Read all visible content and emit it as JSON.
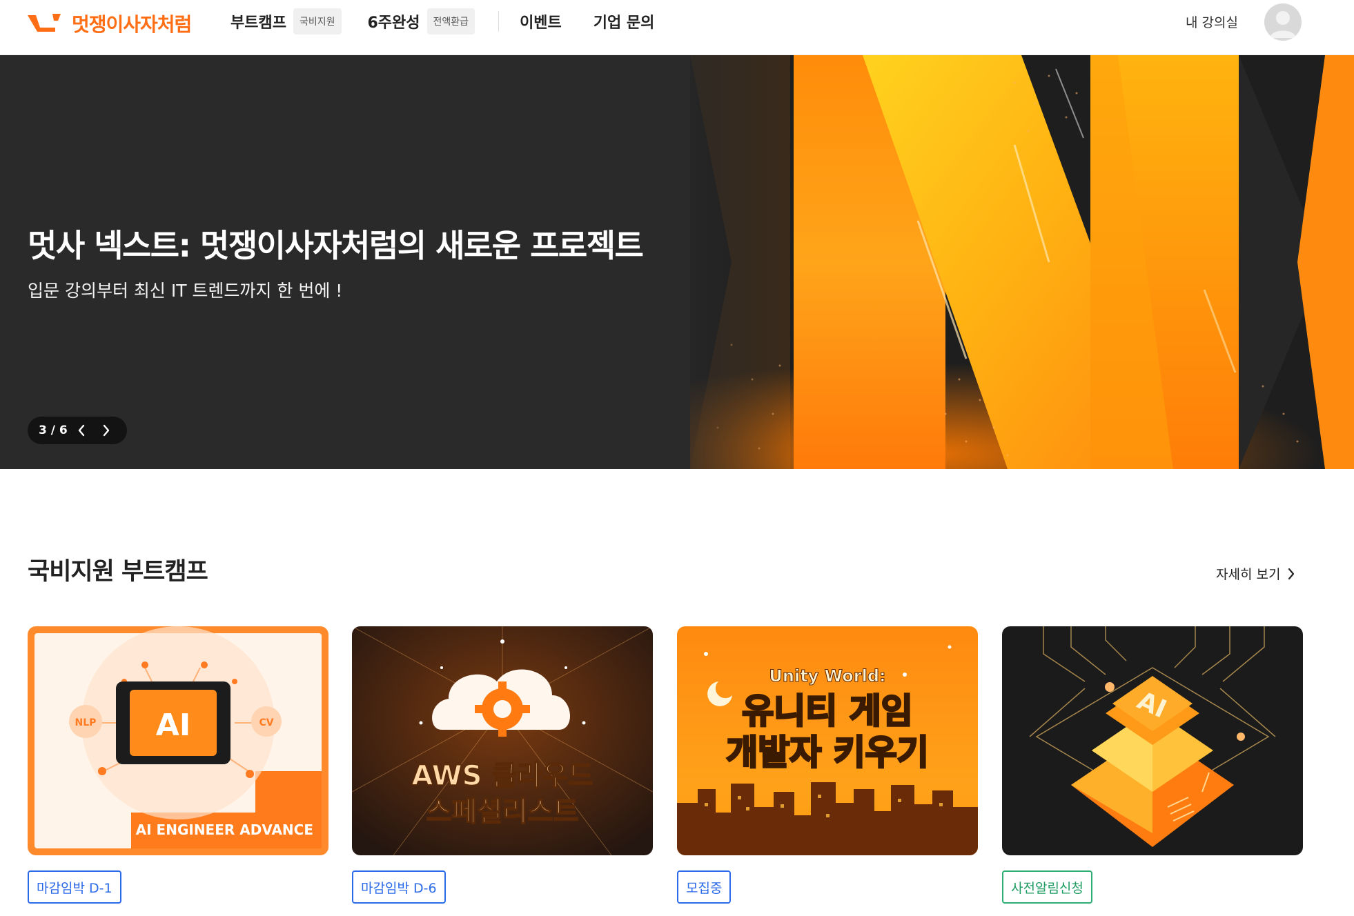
{
  "header": {
    "logo_text": "멋쟁이사자처럼",
    "nav": [
      {
        "label": "부트캠프",
        "badge": "국비지원"
      },
      {
        "label": "6주완성",
        "badge": "전액환급"
      },
      {
        "label": "이벤트"
      },
      {
        "label": "기업 문의"
      }
    ],
    "my_course": "내 강의실"
  },
  "hero": {
    "title": "멋사 넥스트: 멋쟁이사자처럼의 새로운 프로젝트",
    "subtitle": "입문 강의부터 최신 IT 트렌드까지 한 번에 !",
    "pager": "3 / 6",
    "prev_icon": "chevron-left-icon",
    "next_icon": "chevron-right-icon"
  },
  "section": {
    "title": "국비지원 부트캠프",
    "more_label": "자세히 보기"
  },
  "cards": [
    {
      "image_text": "AI ENGINEER ADVANCE",
      "chip_main": "AI",
      "chip_left": "NLP",
      "chip_right": "CV",
      "tag": "마감임박 D-1",
      "tag_color": "#2b6ae8"
    },
    {
      "image_text_1": "AWS 클라우드",
      "image_text_2": "스페셜리스트",
      "tag": "마감임박 D-6",
      "tag_color": "#2b6ae8"
    },
    {
      "image_text_top": "Unity World:",
      "image_text_1": "유니티 게임",
      "image_text_2": "개발자 키우기",
      "tag": "모집중",
      "tag_color": "#2b6ae8"
    },
    {
      "image_text": "AI",
      "tag": "사전알림신청",
      "tag_color": "#2fae74"
    }
  ],
  "colors": {
    "brand": "#ff6e14",
    "hero_bg": "#2a2a2a",
    "tag_blue": "#2b6ae8",
    "tag_green": "#2fae74"
  }
}
